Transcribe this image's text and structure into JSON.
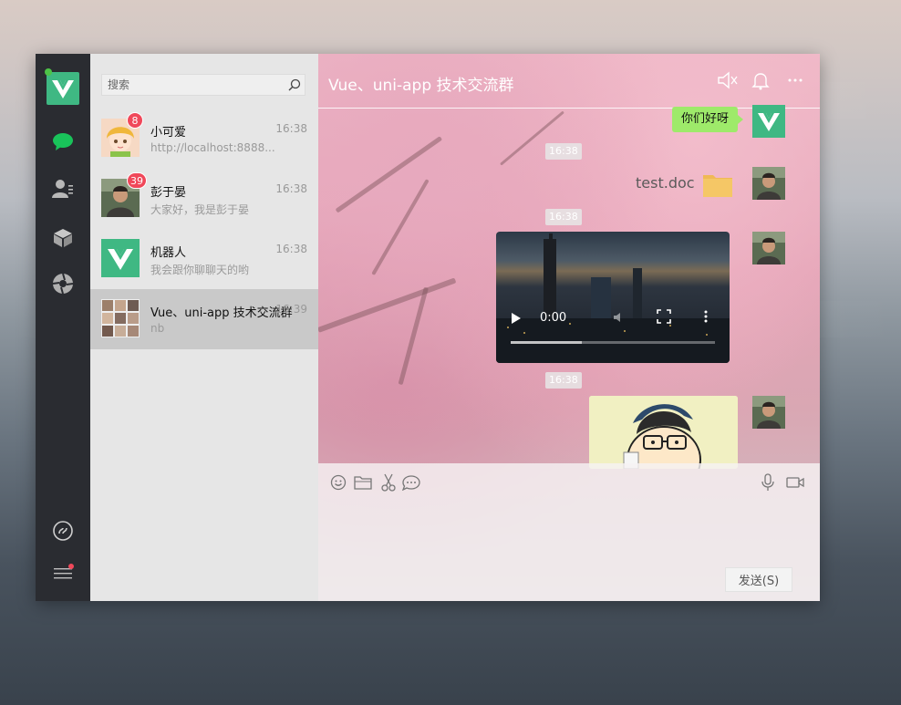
{
  "search": {
    "placeholder": "搜索"
  },
  "conversations": [
    {
      "name": "小可爱",
      "time": "16:38",
      "preview": "http://localhost:8888...",
      "badge": "8"
    },
    {
      "name": "彭于晏",
      "time": "16:38",
      "preview": "大家好，我是彭于晏",
      "badge": "39"
    },
    {
      "name": "机器人",
      "time": "16:38",
      "preview": "我会跟你聊聊天的哟",
      "badge": ""
    },
    {
      "name": "Vue、uni-app 技术交流群",
      "time": "16:39",
      "preview": "nb",
      "badge": ""
    }
  ],
  "chat": {
    "title": "Vue、uni-app 技术交流群",
    "messages": {
      "greeting": "你们好呀",
      "ts1": "16:38",
      "file_name": "test.doc",
      "ts2": "16:38",
      "video_time": "0:00",
      "ts3": "16:38"
    },
    "send_label": "发送(S)"
  },
  "colors": {
    "accent": "#3fb883",
    "rail": "#2a2c31",
    "list_bg": "#e6e6e6",
    "bubble": "#9eea6a",
    "badge": "#f0485a"
  }
}
